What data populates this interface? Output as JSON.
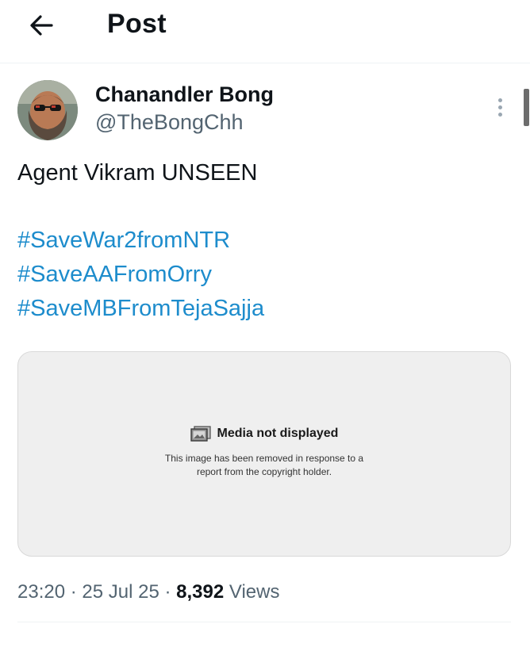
{
  "header": {
    "title": "Post"
  },
  "author": {
    "name": "Chanandler Bong",
    "handle": "@TheBongChh"
  },
  "tweet": {
    "text": "Agent Vikram UNSEEN",
    "hashtags": [
      "#SaveWar2fromNTR",
      "#SaveAAFromOrry",
      "#SaveMBFromTejaSajja"
    ]
  },
  "media": {
    "title": "Media not displayed",
    "line1": "This image has been removed in response to a",
    "line2": "report from the copyright holder."
  },
  "meta": {
    "time": "23:20",
    "date": "25 Jul 25",
    "separator": "·",
    "views_count": "8,392",
    "views_label": "Views"
  },
  "colors": {
    "link": "#1d8ccc",
    "secondary": "#536471"
  }
}
